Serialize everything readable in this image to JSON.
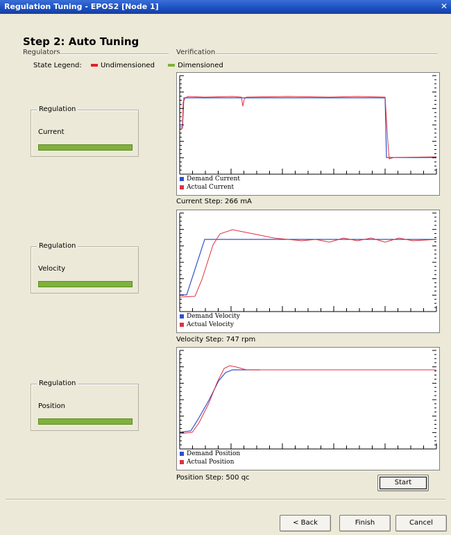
{
  "window": {
    "title": "Regulation Tuning - EPOS2 [Node 1]",
    "close_glyph": "✕"
  },
  "step_title": "Step 2: Auto Tuning",
  "sections": {
    "regulators": "Regulators",
    "verification": "Verification"
  },
  "legend": {
    "label": "State Legend:",
    "undimensioned": "Undimensioned",
    "dimensioned": "Dimensioned",
    "undimensioned_color": "#e0202a",
    "dimensioned_color": "#7fb23a"
  },
  "regulators": [
    {
      "group": "Regulation",
      "name": "Current",
      "state": "dimensioned"
    },
    {
      "group": "Regulation",
      "name": "Velocity",
      "state": "dimensioned"
    },
    {
      "group": "Regulation",
      "name": "Position",
      "state": "dimensioned"
    }
  ],
  "plots": [
    {
      "demand_label": "Demand Current",
      "actual_label": "Actual Current",
      "caption": "Current Step: 266 mA"
    },
    {
      "demand_label": "Demand Velocity",
      "actual_label": "Actual Velocity",
      "caption": "Velocity Step: 747 rpm"
    },
    {
      "demand_label": "Demand Position",
      "actual_label": "Actual Position",
      "caption": "Position Step: 500 qc"
    }
  ],
  "series_colors": {
    "demand": "#3050c8",
    "actual": "#e03040"
  },
  "buttons": {
    "start": "Start",
    "back": "< Back",
    "finish": "Finish",
    "cancel": "Cancel"
  }
}
